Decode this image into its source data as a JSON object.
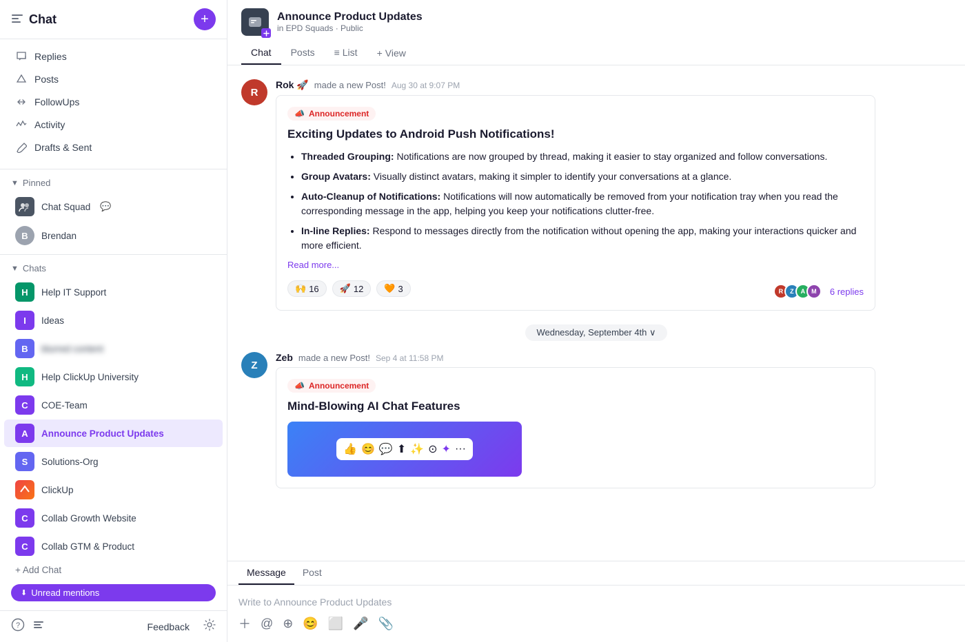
{
  "sidebar": {
    "title": "Chat",
    "toggle_icon": "☰",
    "new_btn": "+",
    "nav_items": [
      {
        "id": "replies",
        "label": "Replies",
        "icon": "💬"
      },
      {
        "id": "posts",
        "label": "Posts",
        "icon": "△"
      },
      {
        "id": "followups",
        "label": "FollowUps",
        "icon": "⇄"
      },
      {
        "id": "activity",
        "label": "Activity",
        "icon": "∿"
      },
      {
        "id": "drafts",
        "label": "Drafts & Sent",
        "icon": "➤"
      }
    ],
    "pinned_section": "Pinned",
    "pinned_items": [
      {
        "id": "chat-squad",
        "name": "Chat Squad",
        "emoji": "💬",
        "avatar_bg": "#6b7280"
      },
      {
        "id": "brendan",
        "name": "Brendan",
        "avatar_bg": "#9ca3af",
        "is_person": true
      }
    ],
    "chats_section": "Chats",
    "chat_items": [
      {
        "id": "help-it",
        "name": "Help IT Support",
        "avatar_bg": "#059669",
        "avatar_text": "H"
      },
      {
        "id": "ideas",
        "name": "Ideas",
        "avatar_bg": "#7c3aed",
        "avatar_text": "I"
      },
      {
        "id": "blurred",
        "name": "blurred content",
        "blurred": true,
        "avatar_bg": "#6366f1",
        "avatar_text": "B"
      },
      {
        "id": "help-clickup",
        "name": "Help ClickUp University",
        "avatar_bg": "#10b981",
        "avatar_text": "H"
      },
      {
        "id": "coe-team",
        "name": "COE-Team",
        "avatar_bg": "#7c3aed",
        "avatar_text": "C"
      },
      {
        "id": "announce",
        "name": "Announce Product Updates",
        "avatar_bg": "#7c3aed",
        "avatar_text": "A",
        "active": true
      },
      {
        "id": "solutions-org",
        "name": "Solutions-Org",
        "avatar_bg": "#6366f1",
        "avatar_text": "S"
      },
      {
        "id": "clickup",
        "name": "ClickUp",
        "avatar_bg": "#ef4444",
        "avatar_text": "C",
        "is_clickup": true
      },
      {
        "id": "collab-growth",
        "name": "Collab Growth Website",
        "avatar_bg": "#7c3aed",
        "avatar_text": "C"
      },
      {
        "id": "collab-gtm",
        "name": "Collab GTM & Product",
        "avatar_bg": "#7c3aed",
        "avatar_text": "C"
      }
    ],
    "add_chat_label": "+ Add Chat",
    "unread_label": "Unread mentions",
    "feedback_label": "Feedback"
  },
  "main": {
    "channel_name": "Announce Product Updates",
    "channel_sub": "in EPD Squads · Public",
    "tabs": [
      {
        "id": "chat",
        "label": "Chat",
        "active": true
      },
      {
        "id": "posts",
        "label": "Posts"
      },
      {
        "id": "list",
        "label": "List",
        "icon": "≡"
      },
      {
        "id": "view",
        "label": "View",
        "icon": "+"
      }
    ],
    "messages": [
      {
        "id": "msg1",
        "author": "Rok 🚀",
        "action": "made a new Post!",
        "timestamp": "Aug 30 at 9:07 PM",
        "avatar_initials": "R",
        "avatar_class": "rok",
        "post": {
          "badge": "📣 Announcement",
          "title": "Exciting Updates to Android Push Notifications!",
          "bullets": [
            {
              "bold": "Threaded Grouping:",
              "text": " Notifications are now grouped by thread, making it easier to stay organized and follow conversations."
            },
            {
              "bold": "Group Avatars:",
              "text": " Visually distinct avatars, making it simpler to identify your conversations at a glance."
            },
            {
              "bold": "Auto-Cleanup of Notifications:",
              "text": " Notifications will now automatically be removed from your notification tray when you read the corresponding message in the app, helping you keep your notifications clutter-free."
            },
            {
              "bold": "In-line Replies:",
              "text": " Respond to messages directly from the notification without opening the app, making your interactions quicker and more efficient."
            }
          ],
          "read_more": "Read more...",
          "reactions": [
            {
              "emoji": "🙌",
              "count": "16"
            },
            {
              "emoji": "🚀",
              "count": "12"
            },
            {
              "emoji": "🧡",
              "count": "3"
            }
          ],
          "replies_count": "6 replies"
        }
      },
      {
        "id": "msg2",
        "author": "Zeb",
        "action": "made a new Post!",
        "timestamp": "Sep 4 at 11:58 PM",
        "avatar_initials": "Z",
        "avatar_class": "zeb",
        "post": {
          "badge": "📣 Announcement",
          "title": "Mind-Blowing AI Chat Features"
        }
      }
    ],
    "date_divider": "Wednesday, September 4th ∨",
    "message_input": {
      "tabs": [
        "Message",
        "Post"
      ],
      "active_tab": "Message",
      "placeholder": "Write to Announce Product Updates"
    }
  }
}
